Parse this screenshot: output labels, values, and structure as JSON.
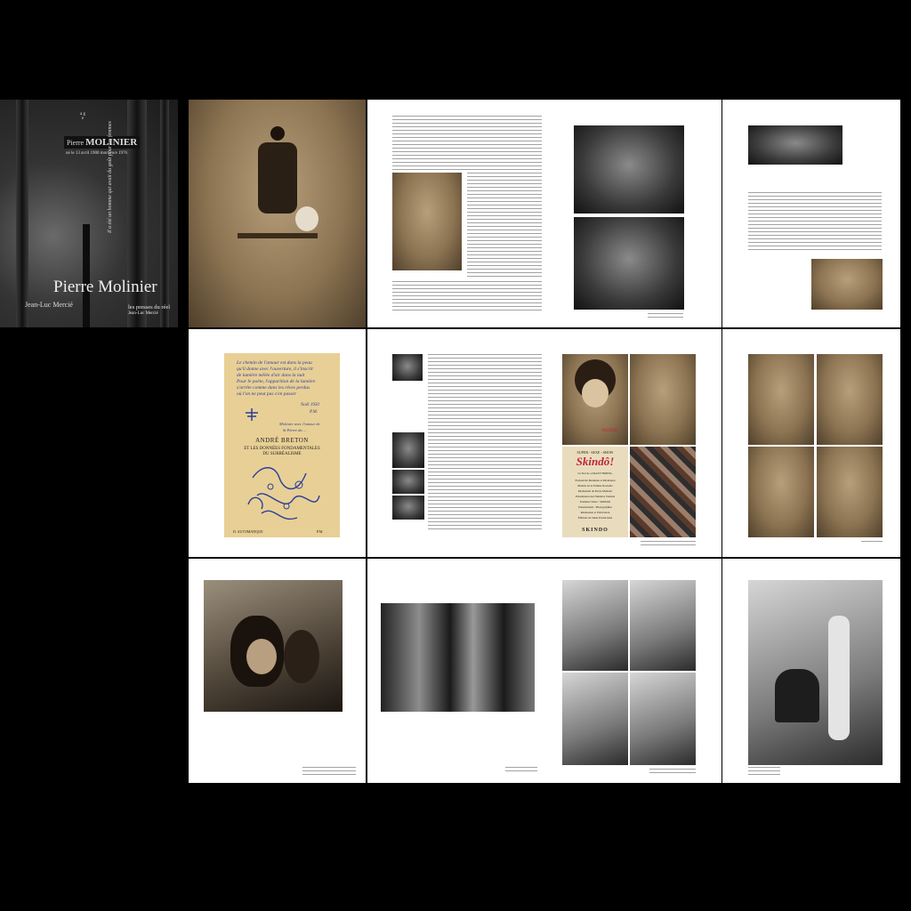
{
  "cover": {
    "title": "Pierre Molinier",
    "author": "Jean-Luc Mercié",
    "publisher_line1": "les presses du réel",
    "publisher_line2": "Jean-Luc Mercié",
    "name_first": "Pierre",
    "name_last": "MOLINIER",
    "dates": "né le 13 avril 1900 mort en/e 1976",
    "age_column": "a g e",
    "vertical_text": "Il a été un homme qui avait du goût pour les femmes"
  },
  "breton_card": {
    "handwriting": [
      "Le chemin de l'amour est dans la peau",
      "qu'il donne avec l'ouverture, il s'inscrit",
      "de lumière mêlée d'air dans la nuit",
      "Pour le poète, l'apparition de la lumière",
      "s'arrête comme dans les rêves perdus",
      "où l'on ne peut pas s'en passer"
    ],
    "signature_date": "Noël 1950",
    "signature_initials": "P.M.",
    "inscription": "Molinier avec l'amour de",
    "inscription2": "St Pierre du ...",
    "title": "ANDRÉ BRETON",
    "subtitle1": "ET LES DONNÉES FONDAMENTALES",
    "subtitle2": "DU SURRÉALISME",
    "bottom": "D. AUTOMATIQUE"
  },
  "skindo_poster": {
    "top_line": "SUPER - SEXE - SHOW",
    "logo": "Skindô!",
    "lines": [
      "La Star de «CRAZY HORSE»",
      "Exclusivité Mondiale et Révélation",
      "Modèle de la Femme Nouvelle",
      "Réalisation de Pierre Molinier",
      "Présentation des Numéros Variétés",
      "Première Visite : SKINDO",
      "Présentations : Photographies",
      "Réalisation et Fabrication",
      "Éditions de Sakia Productions"
    ],
    "bottom": "SKINDO"
  },
  "photo_watermark": "SKINDÔ",
  "marks": {
    "signature_mark": "P.M."
  }
}
